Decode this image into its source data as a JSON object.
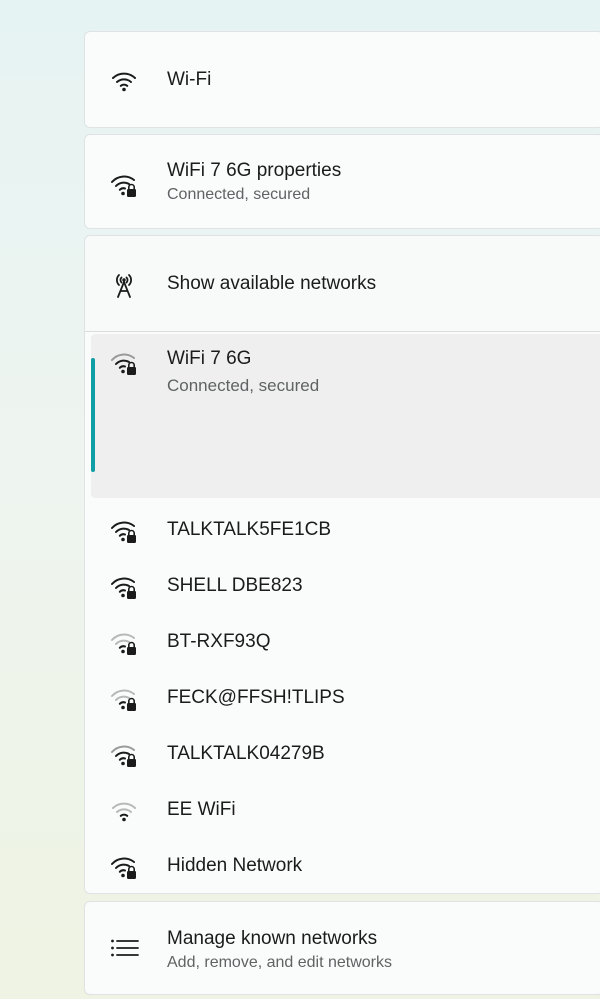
{
  "wifi": {
    "label": "Wi-Fi"
  },
  "properties": {
    "title": "WiFi 7 6G properties",
    "status": "Connected, secured"
  },
  "show_networks": {
    "label": "Show available networks"
  },
  "connected_network": {
    "name": "WiFi 7 6G",
    "status": "Connected, secured"
  },
  "networks": [
    {
      "name": "TALKTALK5FE1CB",
      "icon": "wifi-secured-icon"
    },
    {
      "name": "SHELL DBE823",
      "icon": "wifi-secured-icon"
    },
    {
      "name": "BT-RXF93Q",
      "icon": "wifi-secured-icon"
    },
    {
      "name": "FECK@FFSH!TLIPS",
      "icon": "wifi-secured-icon"
    },
    {
      "name": "TALKTALK04279B",
      "icon": "wifi-secured-icon"
    },
    {
      "name": "EE WiFi",
      "icon": "wifi-open-icon"
    },
    {
      "name": "Hidden Network",
      "icon": "wifi-secured-icon"
    }
  ],
  "manage": {
    "title": "Manage known networks",
    "subtitle": "Add, remove, and edit networks"
  },
  "colors": {
    "accent": "#0f9ea5",
    "text": "#1b1b1b",
    "secondary_text": "#5f6363"
  }
}
